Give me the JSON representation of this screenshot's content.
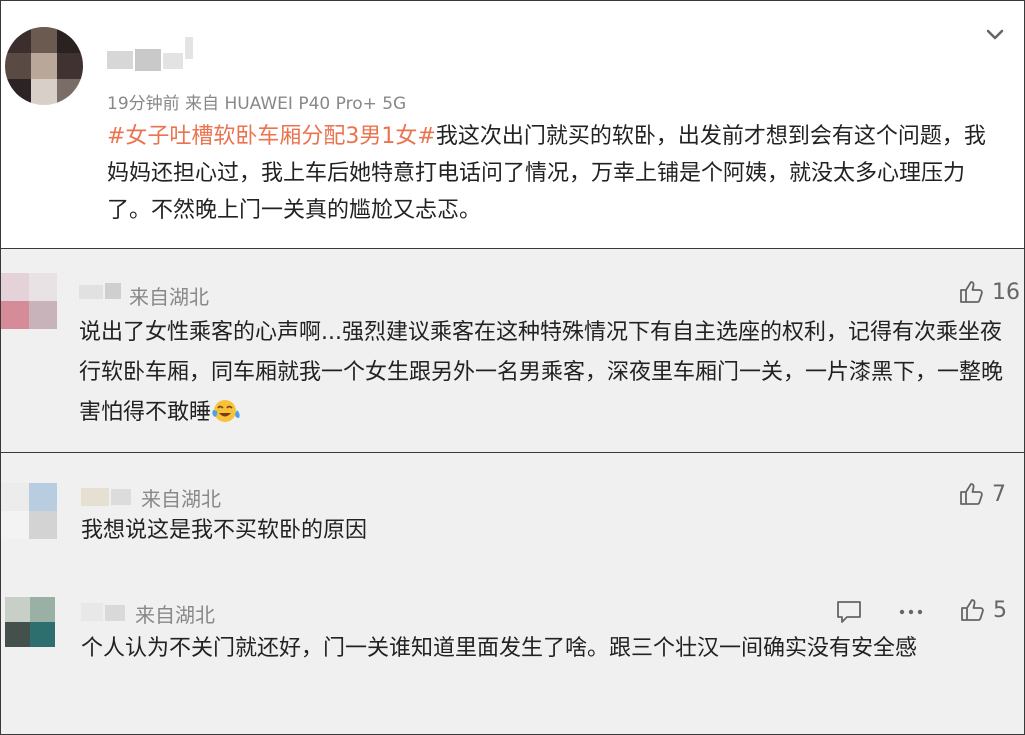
{
  "post": {
    "meta": "19分钟前  来自 HUAWEI P40 Pro+ 5G",
    "hashtag": "#女子吐槽软卧车厢分配3男1女#",
    "text": "我这次出门就买的软卧，出发前才想到会有这个问题，我妈妈还担心过，我上车后她特意打电话问了情况，万幸上铺是个阿姨，就没太多心理压力了。不然晚上门一关真的尴尬又忐忑。"
  },
  "comments": [
    {
      "region": "来自湖北",
      "text": "说出了女性乘客的心声啊...强烈建议乘客在这种特殊情况下有自主选座的权利，记得有次乘坐夜行软卧车厢，同车厢就我一个女生跟另外一名男乘客，深夜里车厢门一关，一片漆黑下，一整晚害怕得不敢睡",
      "likes": "16",
      "emoji": "laugh-cry-emoji"
    },
    {
      "region": "来自湖北",
      "text": "我想说这是我不买软卧的原因",
      "likes": "7"
    },
    {
      "region": "来自湖北",
      "text": "个人认为不关门就还好，门一关谁知道里面发生了啥。跟三个壮汉一间确实没有安全感",
      "likes": "5"
    }
  ],
  "icons": {
    "chevron": "chevron-down-icon",
    "like": "thumbs-up-icon",
    "comment": "comment-icon",
    "more": "more-icon"
  },
  "colors": {
    "hashtag": "#eb7350",
    "comment_bg": "#f0f0f0",
    "text": "#222222",
    "meta": "#888888"
  }
}
